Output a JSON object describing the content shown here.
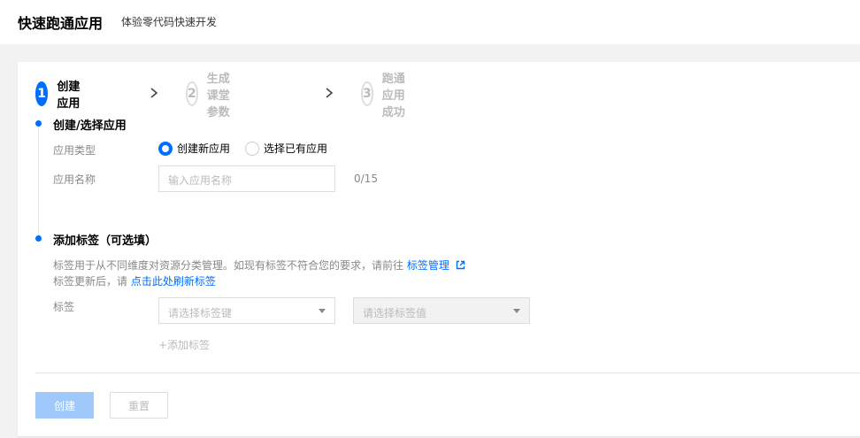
{
  "header": {
    "title": "快速跑通应用",
    "subtitle": "体验零代码快速开发"
  },
  "steps": [
    {
      "num": "1",
      "label": "创建应用",
      "state": "active"
    },
    {
      "num": "2",
      "label": "生成课堂参数",
      "state": "inactive"
    },
    {
      "num": "3",
      "label": "跑通应用成功",
      "state": "inactive"
    }
  ],
  "section_app": {
    "title": "创建/选择应用",
    "type_label": "应用类型",
    "radio_new": "创建新应用",
    "radio_existing": "选择已有应用",
    "name_label": "应用名称",
    "name_placeholder": "输入应用名称",
    "name_counter": "0/15"
  },
  "section_tags": {
    "title": "添加标签（可选填）",
    "desc_line1": "标签用于从不同维度对资源分类管理。如现有标签不符合您的要求，请前往",
    "desc_link1": "标签管理",
    "desc_line2": "标签更新后，请",
    "desc_link2": "点击此处刷新标签",
    "tag_label": "标签",
    "key_placeholder": "请选择标签键",
    "value_placeholder": "请选择标签值",
    "add_tag": "+添加标签"
  },
  "actions": {
    "create": "创建",
    "reset": "重置"
  },
  "colors": {
    "accent": "#006eff",
    "disabled_primary": "#9fc8fb"
  }
}
